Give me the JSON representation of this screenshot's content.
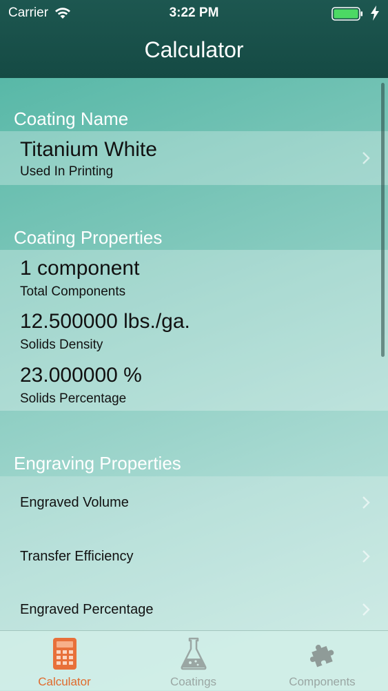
{
  "status_bar": {
    "carrier": "Carrier",
    "time": "3:22 PM"
  },
  "nav": {
    "title": "Calculator"
  },
  "sections": {
    "coating_name": {
      "header": "Coating Name",
      "title": "Titanium White",
      "subtitle": "Used In Printing"
    },
    "coating_properties": {
      "header": "Coating Properties",
      "rows": [
        {
          "value": "1 component",
          "label": "Total Components"
        },
        {
          "value": "12.500000 lbs./ga.",
          "label": "Solids Density"
        },
        {
          "value": "23.000000 %",
          "label": "Solids Percentage"
        }
      ]
    },
    "engraving_properties": {
      "header": "Engraving Properties",
      "rows": [
        {
          "label": "Engraved Volume"
        },
        {
          "label": "Transfer Efficiency"
        },
        {
          "label": "Engraved Percentage"
        }
      ]
    }
  },
  "tabs": [
    {
      "label": "Calculator",
      "icon": "calculator-icon",
      "active": true
    },
    {
      "label": "Coatings",
      "icon": "flask-icon",
      "active": false
    },
    {
      "label": "Components",
      "icon": "puzzle-icon",
      "active": false
    }
  ],
  "colors": {
    "header": "#1d5750",
    "active_tab": "#e06a2c",
    "inactive_tab": "#9aa6a3",
    "battery": "#4cd964"
  }
}
